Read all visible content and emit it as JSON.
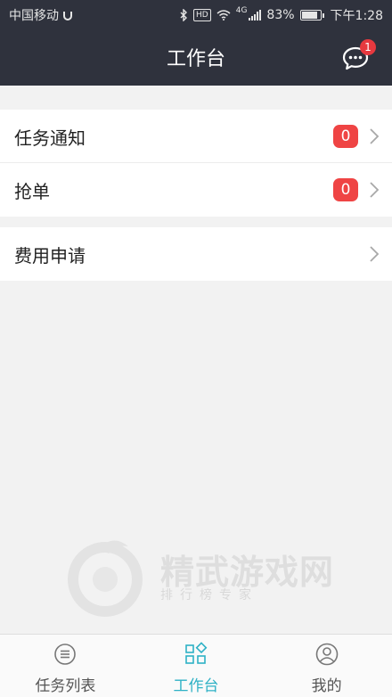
{
  "status_bar": {
    "carrier": "中国移动",
    "hd": "HD",
    "network": "4G",
    "battery": "83%",
    "battery_level": 0.83,
    "time": "下午1:28"
  },
  "header": {
    "title": "工作台",
    "message_badge": "1"
  },
  "menu_groups": [
    {
      "items": [
        {
          "label": "任务通知",
          "count": "0"
        },
        {
          "label": "抢单",
          "count": "0"
        }
      ]
    },
    {
      "items": [
        {
          "label": "费用申请"
        }
      ]
    }
  ],
  "watermark": {
    "text": "精武游戏网",
    "subtitle": "排行榜专家"
  },
  "tab_bar": {
    "tabs": [
      {
        "label": "任务列表",
        "icon": "list-icon"
      },
      {
        "label": "工作台",
        "icon": "workbench-icon",
        "active": true
      },
      {
        "label": "我的",
        "icon": "profile-icon"
      }
    ]
  },
  "colors": {
    "header_bg": "#2f323d",
    "badge_red": "#ef4444",
    "active_tab": "#2eb1c5"
  }
}
